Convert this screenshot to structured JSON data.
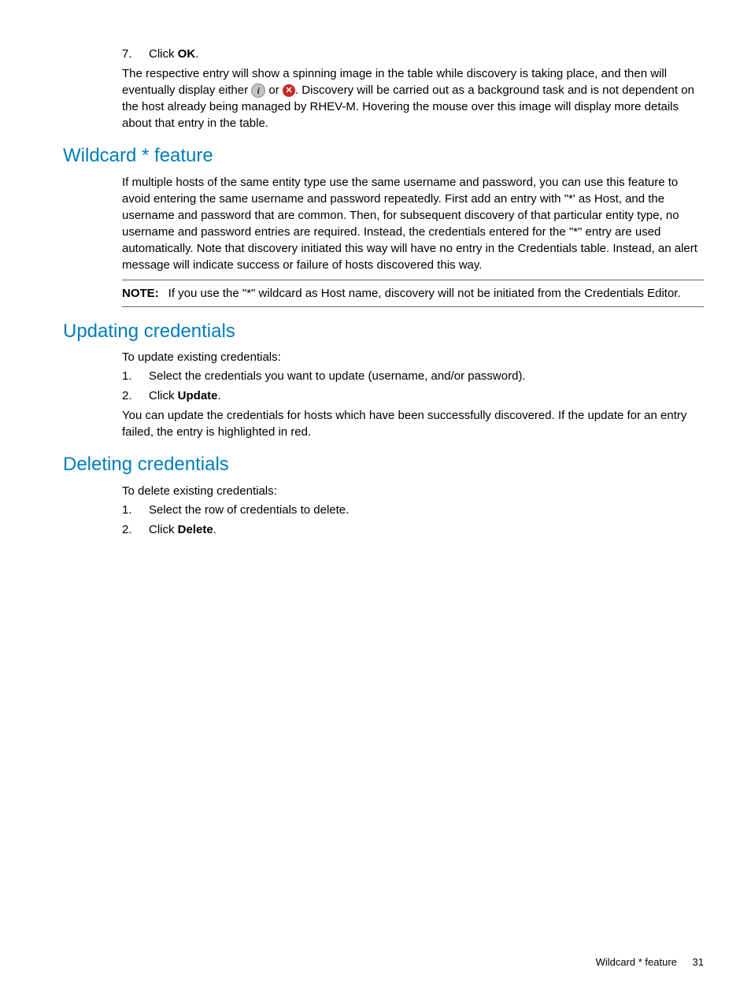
{
  "step7": {
    "num": "7.",
    "prefix": "Click ",
    "bold": "OK",
    "suffix": "."
  },
  "after7": {
    "line1": "The respective entry will show a spinning image in the table while discovery is taking place, and",
    "line2_pre": "then will eventually display either ",
    "line2_mid": " or ",
    "line2_post": ". Discovery will be carried out as a background task and is not dependent on the host already being managed by RHEV-M. Hovering the mouse over this image will display more details about that entry in the table."
  },
  "wildcard": {
    "title": "Wildcard * feature",
    "body": "If multiple hosts of the same entity type use the same username and password, you can use this feature to avoid entering the same username and password repeatedly. First add an entry with \"*' as Host, and the username and password that are common. Then, for subsequent discovery of that particular entity type, no username and password entries are required. Instead, the credentials entered for the \"*\" entry are used automatically. Note that discovery initiated this way will have no entry in the Credentials table. Instead, an alert message will indicate success or failure of hosts discovered this way.",
    "note_label": "NOTE:",
    "note_text": "If you use the \"*\" wildcard as Host name, discovery will not be initiated from the Credentials Editor."
  },
  "updating": {
    "title": "Updating credentials",
    "intro": "To update existing credentials:",
    "step1_num": "1.",
    "step1": "Select the credentials you want to update (username, and/or password).",
    "step2_num": "2.",
    "step2_prefix": "Click ",
    "step2_bold": "Update",
    "step2_suffix": ".",
    "outro": "You can update the credentials for hosts which have been successfully discovered. If the update for an entry failed, the entry is highlighted in red."
  },
  "deleting": {
    "title": "Deleting credentials",
    "intro": "To delete existing credentials:",
    "step1_num": "1.",
    "step1": "Select the row of credentials to delete.",
    "step2_num": "2.",
    "step2_prefix": "Click ",
    "step2_bold": "Delete",
    "step2_suffix": "."
  },
  "footer": {
    "section": "Wildcard * feature",
    "page": "31"
  },
  "icons": {
    "info": "i",
    "error": "✕"
  }
}
